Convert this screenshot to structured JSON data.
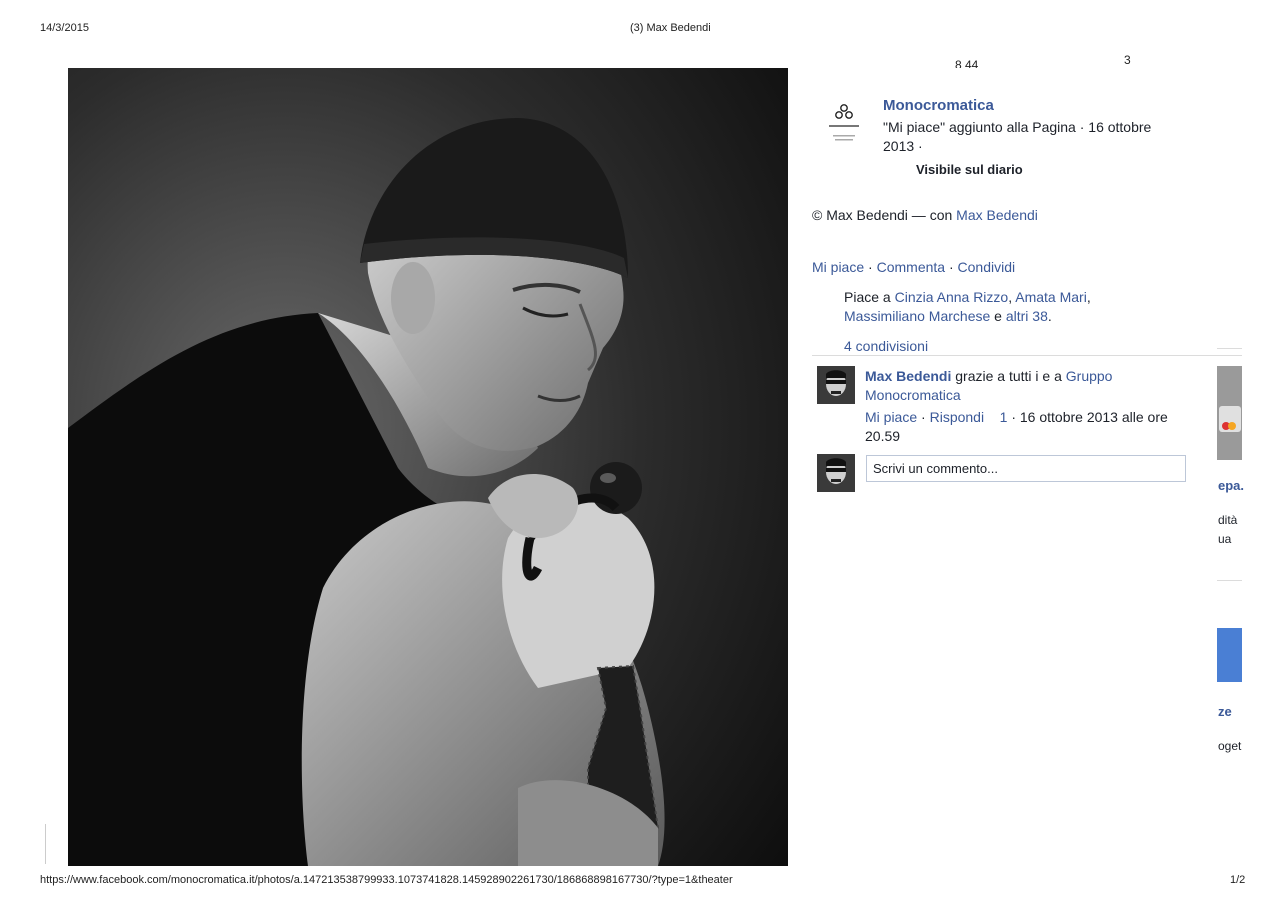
{
  "print_header": {
    "date": "14/3/2015",
    "title": "(3) Max Bedendi"
  },
  "print_footer": {
    "url": "https://www.facebook.com/monocromatica.it/photos/a.147213538799933.1073741828.145928902261730/186868898167730/?type=1&theater",
    "page": "1/2"
  },
  "top_right_fragments": {
    "a": "8 44",
    "b": "3"
  },
  "page_info": {
    "logo_icon": "monocromatica-logo-icon",
    "name": "Monocromatica",
    "activity": "\"Mi piace\" aggiunto alla Pagina · 16 ottobre 2013 ·",
    "visibility": "Visibile sul diario"
  },
  "caption": {
    "prefix": "© Max Bedendi — con ",
    "tag": "Max Bedendi"
  },
  "actions": {
    "like": "Mi piace",
    "comment": "Commenta",
    "share": "Condividi",
    "sep": " · "
  },
  "likes": {
    "prefix": "Piace a ",
    "names": [
      "Cinzia Anna Rizzo",
      "Amata Mari",
      "Massimiliano Marchese"
    ],
    "and": " e ",
    "others": "altri 38",
    "end": "."
  },
  "shares": "4 condivisioni",
  "comment": {
    "author": "Max Bedendi",
    "text": " grazie a tutti i e a ",
    "group": "Gruppo Monocromatica",
    "like": "Mi piace",
    "reply": "Rispondi",
    "like_count": "1",
    "timestamp": "· 16 ottobre 2013 alle ore 20.59"
  },
  "comment_box": {
    "placeholder": "Scrivi un commento..."
  },
  "right_edge_fragments": [
    "epa.",
    "dità",
    "ua",
    "ze",
    "oget"
  ]
}
